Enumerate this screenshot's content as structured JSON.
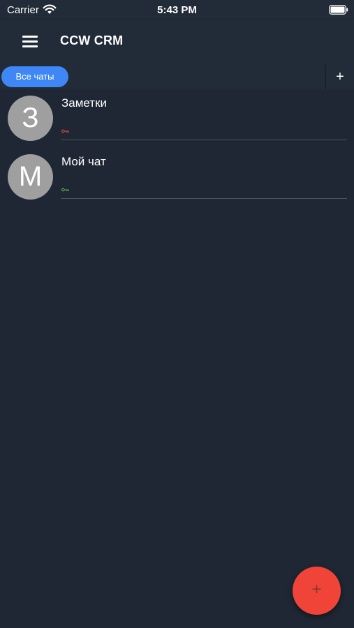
{
  "status_bar": {
    "carrier": "Carrier",
    "time": "5:43 PM",
    "icons": [
      "wifi-icon",
      "battery-icon"
    ]
  },
  "app_bar": {
    "menu_icon": "menu-icon",
    "title": "CCW CRM"
  },
  "tabs": {
    "items": [
      {
        "label": "Все чаты",
        "active": true
      }
    ],
    "add_label": "+"
  },
  "chats": [
    {
      "avatar_letter": "З",
      "name": "Заметки",
      "key_icon": "key-icon",
      "key_color": "#e2473e"
    },
    {
      "avatar_letter": "М",
      "name": "Мой чат",
      "key_icon": "key-icon",
      "key_color": "#4fb04a"
    }
  ],
  "fab": {
    "label": "+",
    "icon": "plus-icon"
  },
  "colors": {
    "background": "#1f2734",
    "app_bar": "#222b38",
    "accent": "#3f87f5",
    "fab": "#f04438",
    "avatar": "#9f9f9f"
  }
}
